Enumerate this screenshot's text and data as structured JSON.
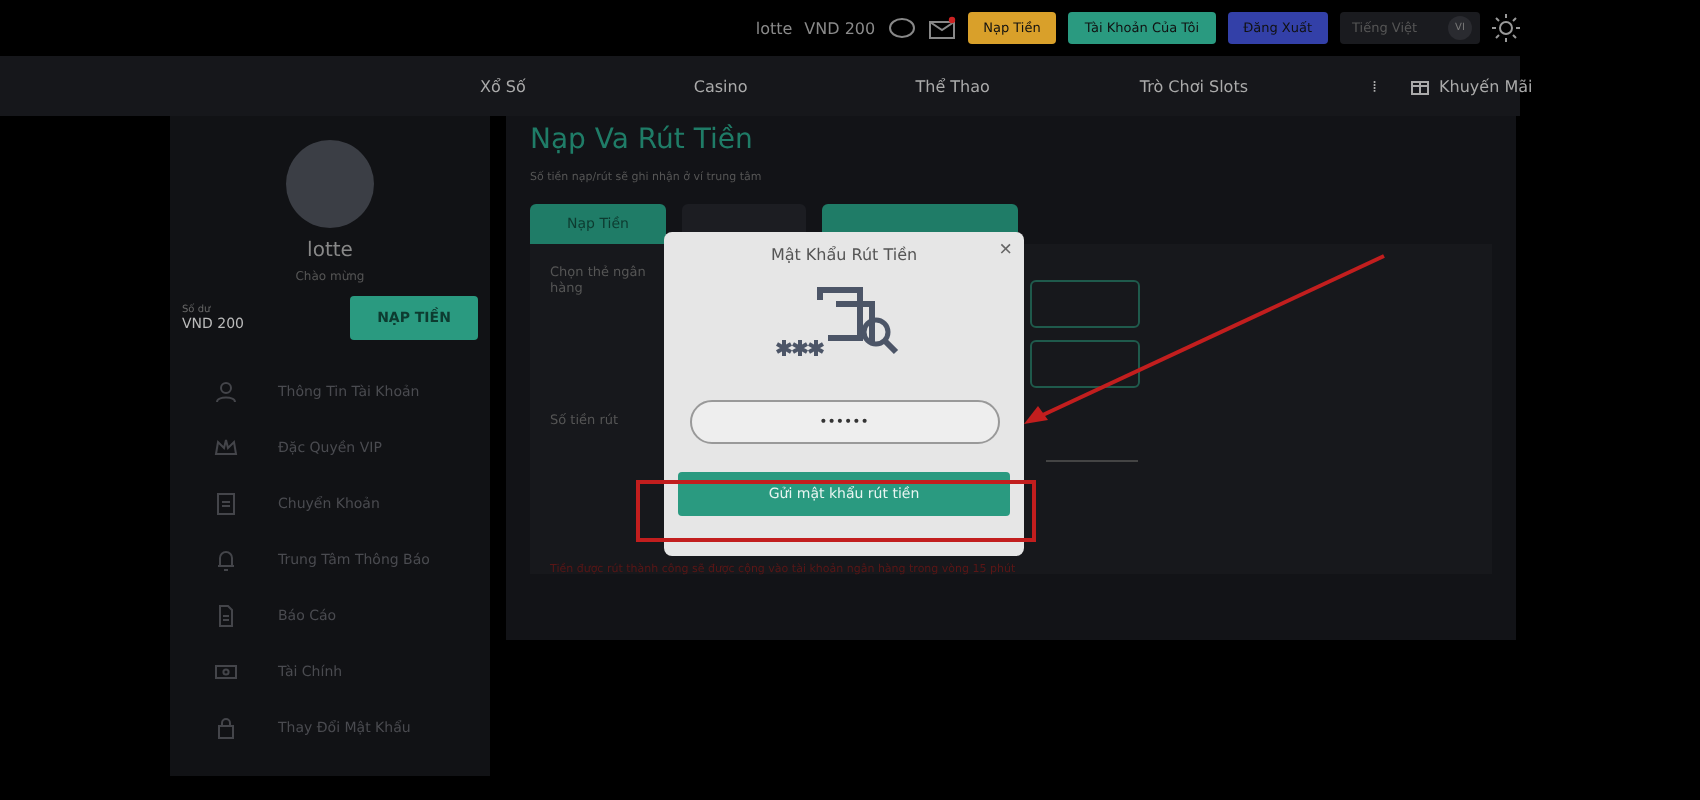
{
  "top_bar": {
    "username": "lotte",
    "balance": "VND 200",
    "buttons": [
      {
        "label": "Nạp Tiền",
        "color": "#d9a02a"
      },
      {
        "label": "Tài Khoản Của Tôi",
        "color": "#2a9a80"
      },
      {
        "label": "Đăng Xuất",
        "color": "#3340a8"
      }
    ],
    "language": {
      "value": "Tiếng Việt",
      "code": "VI"
    }
  },
  "nav": {
    "items": [
      {
        "label": "Xổ Số",
        "kind": "text"
      },
      {
        "label": "Casino",
        "kind": "text"
      },
      {
        "label": "Thể Thao",
        "kind": "text"
      },
      {
        "label": "Trò Chơi Slots",
        "kind": "text"
      },
      {
        "label": "⁞",
        "kind": "text"
      },
      {
        "label": "Khuyến Mãi",
        "kind": "gift"
      }
    ]
  },
  "sidebar": {
    "name": "lotte",
    "greeting": "Chào mừng",
    "balance_label": "Số dư",
    "balance": "VND 200",
    "deposit_button": "NẠP TIỀN",
    "items": [
      {
        "label": "Thông Tin Tài Khoản",
        "kind": "user"
      },
      {
        "label": "Đặc Quyền VIP",
        "kind": "crown"
      },
      {
        "label": "Chuyển Khoản",
        "kind": "transfer"
      },
      {
        "label": "Trung Tâm Thông Báo",
        "kind": "bell"
      },
      {
        "label": "Báo Cáo",
        "kind": "report"
      },
      {
        "label": "Tài Chính",
        "kind": "wallet"
      },
      {
        "label": "Thay Đổi Mật Khẩu",
        "kind": "lock"
      }
    ]
  },
  "main": {
    "title": "Nạp Va Rút Tiền",
    "subtitle": "Số tiền nạp/rút sẽ ghi nhận ở ví trung tâm",
    "tabs": [
      {
        "label": "Nạp Tiền",
        "selected": true
      },
      {
        "selected": false
      },
      {
        "selected": true
      }
    ],
    "bank_label": "Chọn thẻ ngân hàng",
    "amount_label": "Số tiền rút",
    "notice": "Tiền được rút thành công sẽ được cộng vào tài khoản ngân hàng trong vòng 15 phút"
  },
  "modal": {
    "title": "Mật Khẩu Rút Tiền",
    "close": "×",
    "password": "••••••",
    "submit": "Gửi mật khẩu rút tiền"
  }
}
